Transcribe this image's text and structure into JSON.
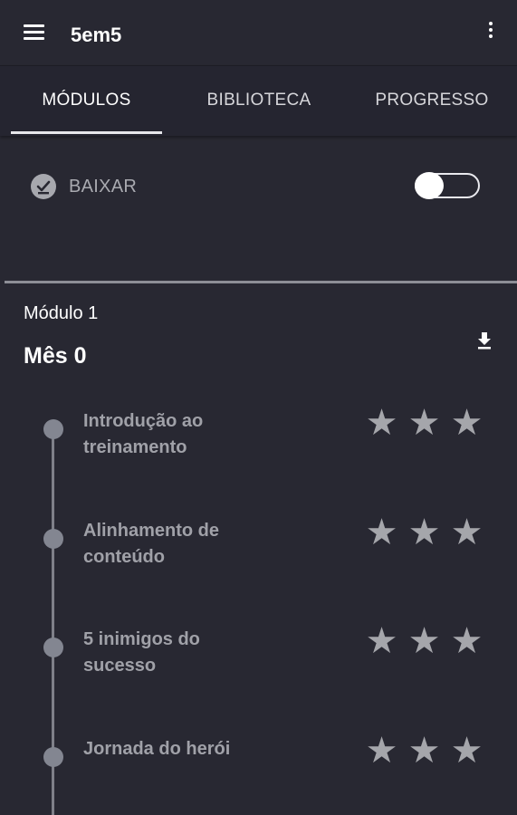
{
  "appbar": {
    "title": "5em5",
    "menu_icon": "hamburger-menu-icon",
    "overflow_icon": "more-vertical-icon"
  },
  "tabs": [
    {
      "label": "MÓDULOS",
      "active": true
    },
    {
      "label": "BIBLIOTECA",
      "active": false
    },
    {
      "label": "PROGRESSO",
      "active": false
    }
  ],
  "download": {
    "label": "BAIXAR",
    "icon": "check-download-icon",
    "toggle_on": false
  },
  "module": {
    "label": "Módulo 1",
    "title": "Mês 0",
    "download_icon": "download-icon"
  },
  "lessons": [
    {
      "title": "Introdução ao treinamento",
      "stars_filled": 0,
      "stars_total": 3
    },
    {
      "title": "Alinhamento de conteúdo",
      "stars_filled": 0,
      "stars_total": 3
    },
    {
      "title": "5 inimigos do sucesso",
      "stars_filled": 0,
      "stars_total": 3
    },
    {
      "title": "Jornada do herói",
      "stars_filled": 0,
      "stars_total": 3
    }
  ],
  "colors": {
    "background": "#282832",
    "tab_bar": "#252530",
    "muted_text": "#a0a1a8",
    "star": "#a5a6ab",
    "timeline": "#838691"
  }
}
